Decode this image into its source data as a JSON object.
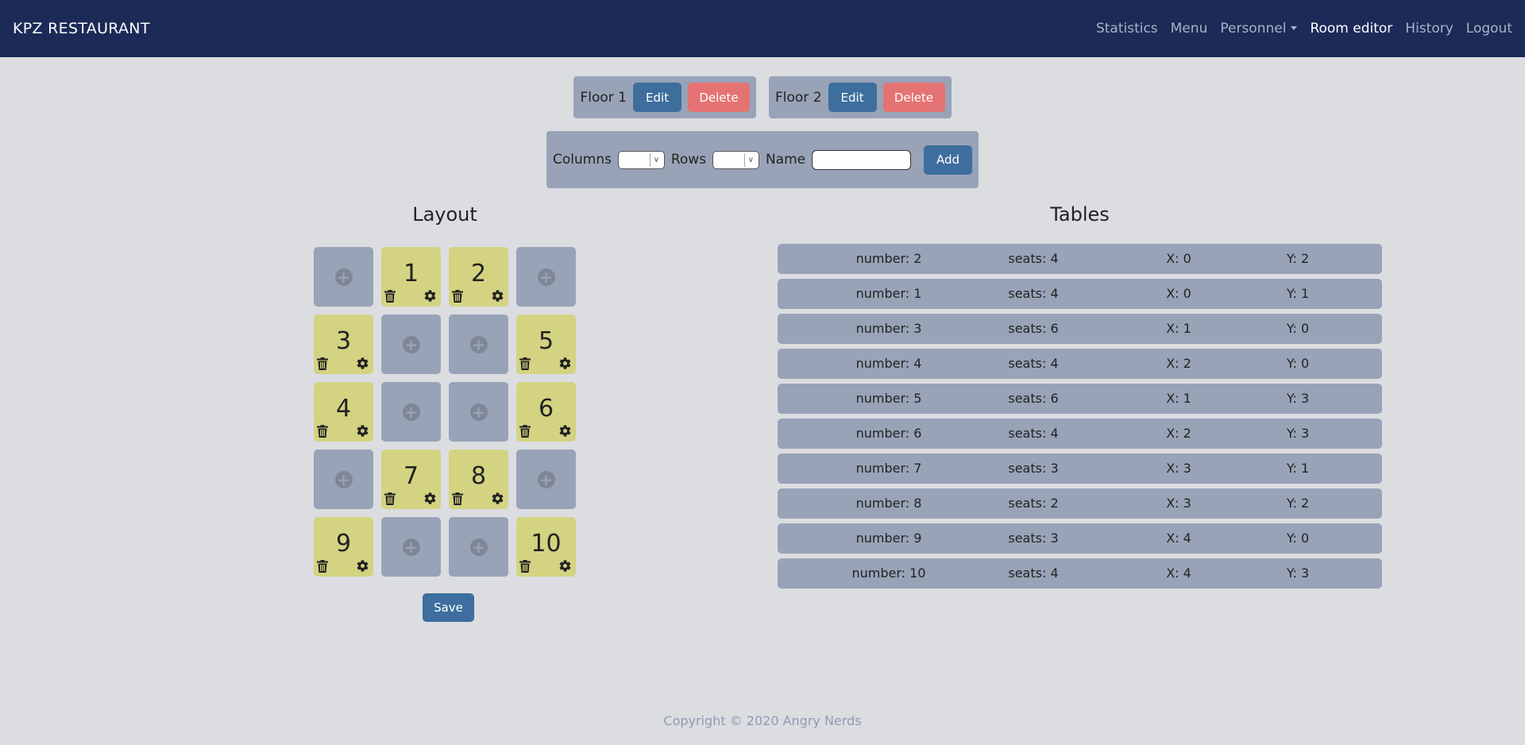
{
  "navbar": {
    "brand": "KPZ RESTAURANT",
    "links": [
      "Statistics",
      "Menu",
      "Personnel",
      "Room editor",
      "History",
      "Logout"
    ]
  },
  "floors": [
    {
      "name": "Floor 1",
      "edit": "Edit",
      "delete": "Delete"
    },
    {
      "name": "Floor 2",
      "edit": "Edit",
      "delete": "Delete"
    }
  ],
  "add_form": {
    "columns_label": "Columns",
    "rows_label": "Rows",
    "name_label": "Name",
    "name_value": "",
    "add_label": "Add"
  },
  "layout": {
    "title": "Layout",
    "grid": [
      [
        "",
        "1",
        "2",
        ""
      ],
      [
        "3",
        "",
        "",
        "5"
      ],
      [
        "4",
        "",
        "",
        "6"
      ],
      [
        "",
        "7",
        "8",
        ""
      ],
      [
        "9",
        "",
        "",
        "10"
      ]
    ],
    "save_label": "Save"
  },
  "tables": {
    "title": "Tables",
    "rows": [
      {
        "number": "number: 2",
        "seats": "seats: 4",
        "x": "X: 0",
        "y": "Y: 2"
      },
      {
        "number": "number: 1",
        "seats": "seats: 4",
        "x": "X: 0",
        "y": "Y: 1"
      },
      {
        "number": "number: 3",
        "seats": "seats: 6",
        "x": "X: 1",
        "y": "Y: 0"
      },
      {
        "number": "number: 4",
        "seats": "seats: 4",
        "x": "X: 2",
        "y": "Y: 0"
      },
      {
        "number": "number: 5",
        "seats": "seats: 6",
        "x": "X: 1",
        "y": "Y: 3"
      },
      {
        "number": "number: 6",
        "seats": "seats: 4",
        "x": "X: 2",
        "y": "Y: 3"
      },
      {
        "number": "number: 7",
        "seats": "seats: 3",
        "x": "X: 3",
        "y": "Y: 1"
      },
      {
        "number": "number: 8",
        "seats": "seats: 2",
        "x": "X: 3",
        "y": "Y: 2"
      },
      {
        "number": "number: 9",
        "seats": "seats: 3",
        "x": "X: 4",
        "y": "Y: 0"
      },
      {
        "number": "number: 10",
        "seats": "seats: 4",
        "x": "X: 4",
        "y": "Y: 3"
      }
    ]
  },
  "footer": "Copyright © 2020 Angry Nerds"
}
